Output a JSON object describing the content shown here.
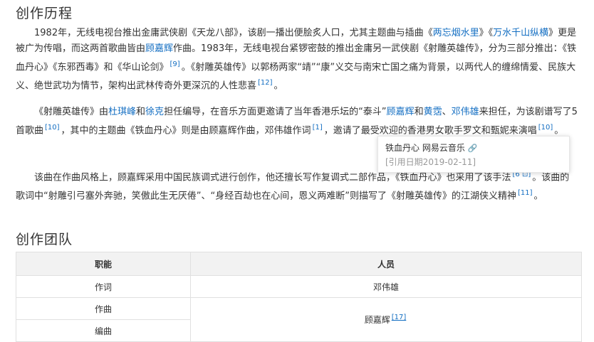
{
  "section1": {
    "heading": "创作历程",
    "p1": {
      "t1": "1982年，无线电视台推出金庸武侠剧《天龙八部》，该剧一播出便脍炙人口，尤其主题曲与插曲《",
      "link1": "两忘烟水里",
      "t2": "》《",
      "link2": "万水千山纵横",
      "t3": "》更是被广为传唱，而这两首歌曲皆由",
      "link3": "顾嘉辉",
      "t4": "作曲。1983年，无线电视台紧锣密鼓的推出金庸另一武侠剧《射雕英雄传》，分为三部分推出：《铁血丹心》《东邪西毒》和《华山论剑》",
      "ref1": "[9]",
      "t5": "。《射雕英雄传》以郭杨两家“靖”“康”义交与南宋亡国之痛为背景，以两代人的缠绵情爱、民族大义、绝世武功为情节，架构出武林传奇外更深沉的人性悲喜",
      "ref2": "[12]",
      "t6": "。"
    },
    "p2": {
      "t1": "《射雕英雄传》由",
      "link1": "杜琪峰",
      "t2": "和",
      "link2": "徐克",
      "t3": "担任编导，在音乐方面更邀请了当年香港乐坛的“泰斗”",
      "link3": "顾嘉辉",
      "t4": "和",
      "link4": "黄霑",
      "t5": "、",
      "link5": "邓伟雄",
      "t6": "来担任，为该剧谱写了5首歌曲",
      "ref1": "[10]",
      "t7": "，其中的主题曲《铁血丹心》则是由顾嘉辉作曲，邓伟雄作词",
      "ref2": "[1]",
      "t8": "，邀请了最受欢迎的香港男女歌手罗文和甄妮来演唱",
      "ref3": "[10]",
      "t9": "。"
    },
    "p3": {
      "t1": "该曲在作曲风格上，顾嘉辉采用中国民族调式进行创作，他还擅长写作复调式二部作品，《铁血丹心》也采用了该手法",
      "ref1": "[6 ⊡]",
      "t2": "。该曲的歌词中“射雕引弓塞外奔驰，笑傲此生无厌倦”、“身经百劫也在心间，恩义两难断”则描写了《射雕英雄传》的江湖侠义精神",
      "ref2": "[11]",
      "t3": "。"
    }
  },
  "tooltip": {
    "title": "铁血丹心 网易云音乐",
    "date": "[引用日期2019-02-11]"
  },
  "section2": {
    "heading": "创作团队",
    "table": {
      "headers": [
        "职能",
        "人员"
      ],
      "rows": [
        {
          "role": "作词",
          "person": "邓伟雄"
        },
        {
          "role": "作曲"
        },
        {
          "role": "编曲"
        }
      ],
      "merged_person": "顾嘉辉",
      "merged_ref": "[17]"
    }
  }
}
